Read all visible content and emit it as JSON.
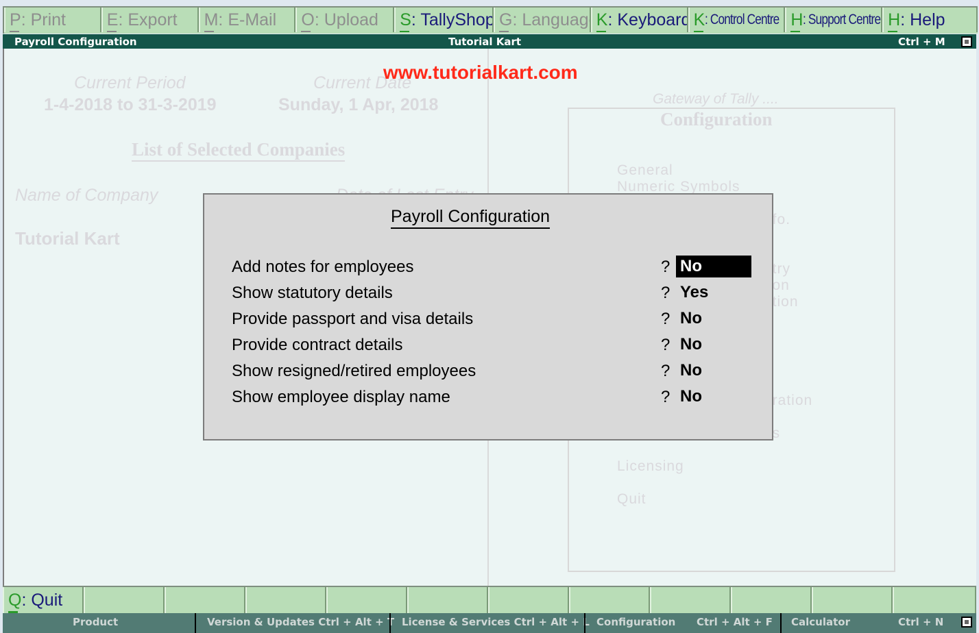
{
  "top_buttons": [
    {
      "key": "P",
      "label": ": Print",
      "enabled": false
    },
    {
      "key": "E",
      "label": ": Export",
      "enabled": false
    },
    {
      "key": "M",
      "label": ": E-Mail",
      "enabled": false
    },
    {
      "key": "O",
      "label": ": Upload",
      "enabled": false
    },
    {
      "key": "S",
      "label": ": TallyShop",
      "enabled": true
    },
    {
      "key": "G",
      "label": ": Language",
      "enabled": false
    },
    {
      "key": "K",
      "label": ": Keyboard",
      "enabled": true
    },
    {
      "key": "K",
      "label": ": Control Centre",
      "enabled": true
    },
    {
      "key": "H",
      "label": ": Support Centre",
      "enabled": true
    },
    {
      "key": "H",
      "label": ": Help",
      "enabled": true
    }
  ],
  "titlebar": {
    "left": "Payroll Configuration",
    "center": "Tutorial Kart",
    "shortcut": "Ctrl + M"
  },
  "watermark": "www.tutorialkart.com",
  "background": {
    "current_period_label": "Current Period",
    "current_period": "1-4-2018 to 31-3-2019",
    "current_date_label": "Current Date",
    "current_date": "Sunday, 1 Apr, 2018",
    "list_title": "List of Selected Companies",
    "col_name": "Name of Company",
    "col_date": "Date of Last Entry",
    "company": "Tutorial Kart",
    "gateway_title": "Gateway of Tally ....",
    "gateway_subtitle": "Configuration",
    "menu_fragments": {
      "general": "General",
      "numeric": "Numeric Symbols",
      "info": "nfo.",
      "entry": "ntry",
      "tion": "tion",
      "ation": "ation",
      "n": "n",
      "uration": "uration",
      "es": "es",
      "licensing": "Licensing",
      "quit": "Quit"
    }
  },
  "dialog": {
    "title": "Payroll Configuration",
    "rows": [
      {
        "label": "Add notes for employees",
        "value": "No",
        "selected": true
      },
      {
        "label": "Show statutory details",
        "value": "Yes",
        "selected": false
      },
      {
        "label": "Provide passport and visa details",
        "value": "No",
        "selected": false
      },
      {
        "label": "Provide contract details",
        "value": "No",
        "selected": false
      },
      {
        "label": "Show resigned/retired employees",
        "value": "No",
        "selected": false
      },
      {
        "label": "Show employee display name",
        "value": "No",
        "selected": false
      }
    ],
    "prompt": "?"
  },
  "bottom_buttons": [
    {
      "key": "Q",
      "label": ": Quit"
    }
  ],
  "statusbar": {
    "product": "Product",
    "version": "Version & Updates Ctrl + Alt + T",
    "license": "License & Services Ctrl + Alt + L",
    "config": "Configuration",
    "config_shortcut": "Ctrl + Alt + F",
    "calculator": "Calculator",
    "calc_shortcut": "Ctrl + N"
  }
}
